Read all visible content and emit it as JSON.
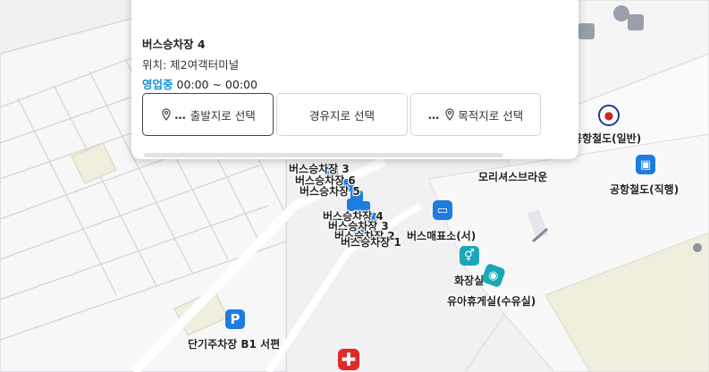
{
  "popup": {
    "title": "버스승차장 4",
    "location": "위치: 제2여객터미널",
    "status": "영업중",
    "hours": " 00:00 ~ 00:00",
    "buttons": {
      "origin": "출발지로 선택",
      "waypoint": "경유지로 선택",
      "destination": "목적지로 선택"
    }
  },
  "map": {
    "labels": {
      "bus_stop_3a": "버스승차장 3",
      "bus_stop_6": "버스승차장 6",
      "bus_stop_5": "버스승차장 5",
      "bus_stop_4": "버스승차장 4",
      "bus_stop_3": "버스승차장 3",
      "bus_stop_2": "버스승차장 2",
      "bus_stop_1": "버스승차장 1",
      "ticket_office": "버스매표소(서)",
      "restroom": "화장실",
      "nursing_room": "유아휴게실(수유실)",
      "cafe": "모리셔스브라운",
      "railroad_general": "공항철도(일반)",
      "railroad_express": "공항철도(직행)",
      "parking": "단기주차장 B1 서편"
    },
    "parking_glyph": "P",
    "colors": {
      "poi_blue": "#1e7be0",
      "poi_teal": "#1aa8b8",
      "status_blue": "#1a8fe0",
      "medical_red": "#e02a2a",
      "parking_lot": "#f0eedc"
    }
  }
}
